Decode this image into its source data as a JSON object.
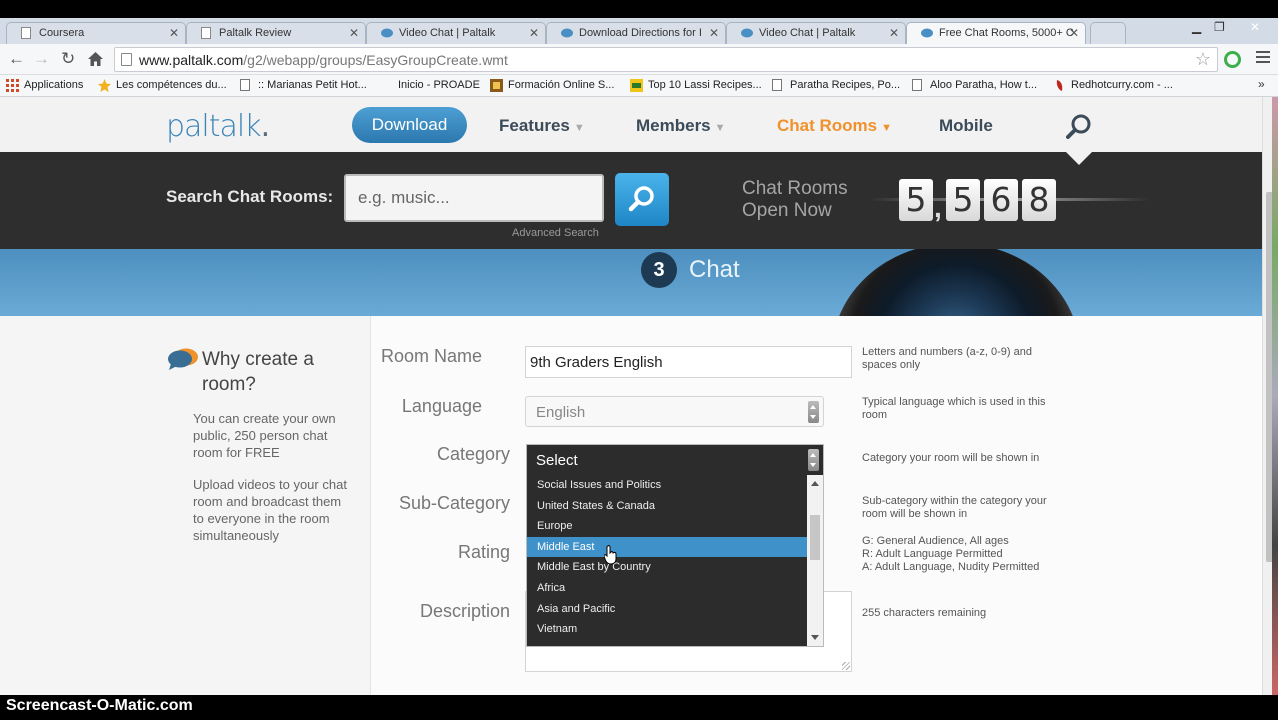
{
  "browser": {
    "tabs": [
      {
        "label": "Coursera",
        "active": false
      },
      {
        "label": "Paltalk Review",
        "active": false
      },
      {
        "label": "Video Chat | Paltalk",
        "active": false
      },
      {
        "label": "Download Directions for I",
        "active": false
      },
      {
        "label": "Video Chat | Paltalk",
        "active": false
      },
      {
        "label": "Free Chat Rooms, 5000+ C",
        "active": true
      }
    ],
    "url_host": "www.paltalk.com",
    "url_path": "/g2/webapp/groups/EasyGroupCreate.wmt",
    "bookmarks": [
      {
        "label": "Applications",
        "icon": "grid-icon"
      },
      {
        "label": "Les compétences du...",
        "icon": "star-icon"
      },
      {
        "label": ":: Marianas Petit Hot...",
        "icon": "page-icon"
      },
      {
        "label": "Inicio - PROADE",
        "icon": "blank"
      },
      {
        "label": "Formación Online S...",
        "icon": "logo-icon"
      },
      {
        "label": "Top 10 Lassi Recipes...",
        "icon": "im-icon"
      },
      {
        "label": "Paratha Recipes, Po...",
        "icon": "page-icon"
      },
      {
        "label": "Aloo Paratha, How t...",
        "icon": "page-icon"
      },
      {
        "label": "Redhotcurry.com - ...",
        "icon": "chili-icon"
      }
    ]
  },
  "site": {
    "logo": "paltalk",
    "download_label": "Download",
    "nav": [
      {
        "label": "Features",
        "caret": "▼",
        "active": false
      },
      {
        "label": "Members",
        "caret": "▼",
        "active": false
      },
      {
        "label": "Chat Rooms",
        "caret": "▼",
        "active": true
      },
      {
        "label": "Mobile",
        "caret": "",
        "active": false
      }
    ]
  },
  "search": {
    "label": "Search Chat Rooms:",
    "placeholder": "e.g. music...",
    "advanced": "Advanced Search",
    "rooms_open_label": "Chat Rooms Open Now",
    "rooms_open_digits": [
      "5",
      "5",
      "6",
      "8"
    ]
  },
  "step": {
    "number": "3",
    "label": "Chat"
  },
  "why": {
    "title": "Why create a room?",
    "p1": "You can create your own public, 250 person chat room for FREE",
    "p2": "Upload videos to your chat room and broadcast them to everyone in the room simultaneously"
  },
  "form": {
    "room_name_label": "Room Name",
    "room_name_value": "9th Graders English",
    "room_name_hint": "Letters and numbers (a-z, 0-9) and spaces only",
    "language_label": "Language",
    "language_value": "English",
    "language_hint": "Typical language which is used in this room",
    "category_label": "Category",
    "category_value": "Select",
    "category_hint": "Category your room will be shown in",
    "subcategory_label": "Sub-Category",
    "subcategory_hint": "Sub-category within the category your room will be shown in",
    "rating_label": "Rating",
    "rating_hint_g": "G: General Audience, All ages",
    "rating_hint_r": "R: Adult Language Permitted",
    "rating_hint_a": "A: Adult Language, Nudity Permitted",
    "description_label": "Description",
    "description_hint": "255  characters remaining"
  },
  "category_options": [
    {
      "label": "Social Issues and Politics",
      "selected": false
    },
    {
      "label": "United States & Canada",
      "selected": false
    },
    {
      "label": "Europe",
      "selected": false
    },
    {
      "label": "Middle East",
      "selected": true
    },
    {
      "label": "Middle East by Country",
      "selected": false
    },
    {
      "label": "Africa",
      "selected": false
    },
    {
      "label": "Asia and Pacific",
      "selected": false
    },
    {
      "label": "Vietnam",
      "selected": false
    }
  ],
  "watermark": "Screencast-O-Matic.com",
  "colors": {
    "brand_blue": "#3a84b8",
    "accent_orange": "#f0922b",
    "selection_blue": "#3e91c9"
  }
}
